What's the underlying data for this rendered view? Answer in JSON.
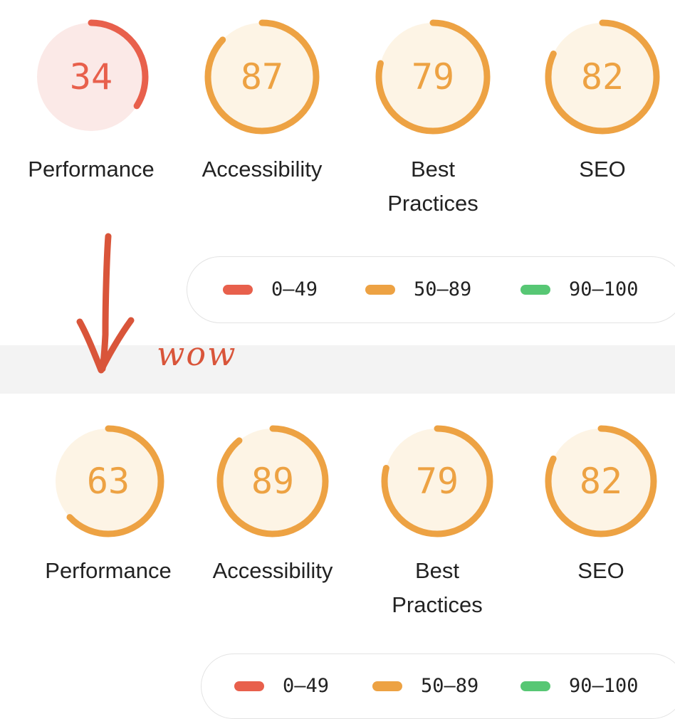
{
  "colors": {
    "fail": "#e8604c",
    "average": "#eda243",
    "pass": "#57c774",
    "fail_bg": "#fbe9e7",
    "average_bg": "#fdf4e5"
  },
  "before": {
    "categories": [
      {
        "label": "Performance",
        "score": "34",
        "fraction": 0.34,
        "rating": "fail"
      },
      {
        "label": "Accessibility",
        "score": "87",
        "fraction": 0.87,
        "rating": "average"
      },
      {
        "label": "Best\nPractices",
        "score": "79",
        "fraction": 0.79,
        "rating": "average"
      },
      {
        "label": "SEO",
        "score": "82",
        "fraction": 0.82,
        "rating": "average"
      }
    ],
    "legend": [
      {
        "range": "0–49",
        "rating": "fail"
      },
      {
        "range": "50–89",
        "rating": "average"
      },
      {
        "range": "90–100",
        "rating": "pass"
      }
    ]
  },
  "after": {
    "categories": [
      {
        "label": "Performance",
        "score": "63",
        "fraction": 0.63,
        "rating": "average"
      },
      {
        "label": "Accessibility",
        "score": "89",
        "fraction": 0.89,
        "rating": "average"
      },
      {
        "label": "Best\nPractices",
        "score": "79",
        "fraction": 0.79,
        "rating": "average"
      },
      {
        "label": "SEO",
        "score": "82",
        "fraction": 0.82,
        "rating": "average"
      }
    ],
    "legend": [
      {
        "range": "0–49",
        "rating": "fail"
      },
      {
        "range": "50–89",
        "rating": "average"
      },
      {
        "range": "90–100",
        "rating": "pass"
      }
    ]
  },
  "annotation": {
    "text": "wow",
    "icon": "hand-drawn-down-arrow-icon"
  }
}
